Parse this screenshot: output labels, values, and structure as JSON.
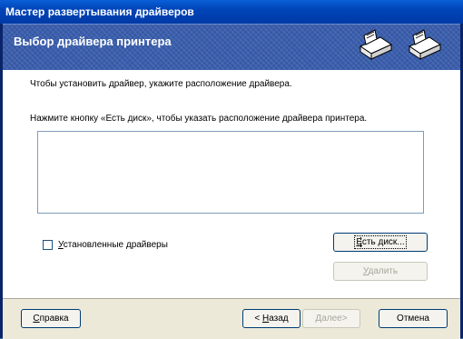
{
  "window": {
    "title": "Мастер развертывания драйверов"
  },
  "banner": {
    "title": "Выбор драйвера принтера"
  },
  "instructions": {
    "line1": "Чтобы установить драйвер, укажите расположение драйвера.",
    "line2": "Нажмите кнопку «Есть диск», чтобы указать расположение драйвера принтера."
  },
  "driver_list": {
    "items": []
  },
  "installed_drivers": {
    "label_accel": "У",
    "label_rest": "становленные драйверы",
    "checked": false
  },
  "buttons": {
    "have_disk": {
      "accel": "Е",
      "rest": "сть диск..."
    },
    "remove": {
      "accel": "У",
      "rest": "далить"
    },
    "help": {
      "accel": "С",
      "rest": "правка"
    },
    "back": {
      "prefix": "< ",
      "accel": "Н",
      "rest": "азад"
    },
    "next": {
      "label": "Далее>"
    },
    "cancel": {
      "label": "Отмена"
    }
  },
  "colors": {
    "titlebar": "#0044b8",
    "banner": "#3b5fae",
    "window_bg": "#ece9d8"
  },
  "icons": [
    "printer-icon",
    "printer-icon"
  ]
}
